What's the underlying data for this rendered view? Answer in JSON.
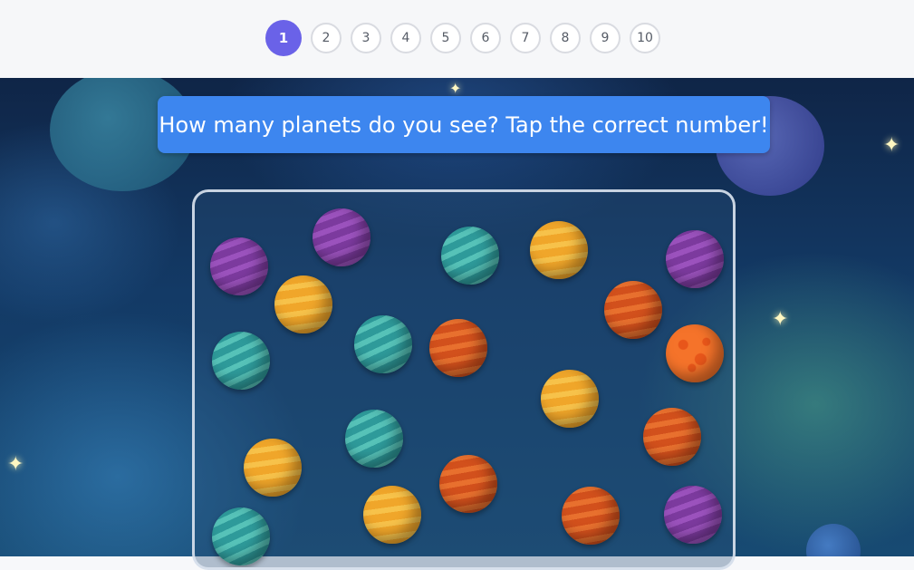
{
  "pagination": {
    "pages": [
      "1",
      "2",
      "3",
      "4",
      "5",
      "6",
      "7",
      "8",
      "9",
      "10"
    ],
    "active": "1"
  },
  "prompt": {
    "text": "How many planets do you see? Tap the correct number!"
  },
  "colors": {
    "accent": "#6a62e8",
    "prompt_bg": "#3d86ef"
  },
  "board": {
    "planets": [
      {
        "kind": "purple"
      },
      {
        "kind": "purple"
      },
      {
        "kind": "teal"
      },
      {
        "kind": "orange"
      },
      {
        "kind": "purple"
      },
      {
        "kind": "orange"
      },
      {
        "kind": "red"
      },
      {
        "kind": "teal"
      },
      {
        "kind": "teal"
      },
      {
        "kind": "red"
      },
      {
        "kind": "spotted"
      },
      {
        "kind": "orange"
      },
      {
        "kind": "teal"
      },
      {
        "kind": "red"
      },
      {
        "kind": "orange"
      },
      {
        "kind": "red"
      },
      {
        "kind": "orange"
      },
      {
        "kind": "red"
      },
      {
        "kind": "purple"
      },
      {
        "kind": "teal"
      }
    ]
  }
}
